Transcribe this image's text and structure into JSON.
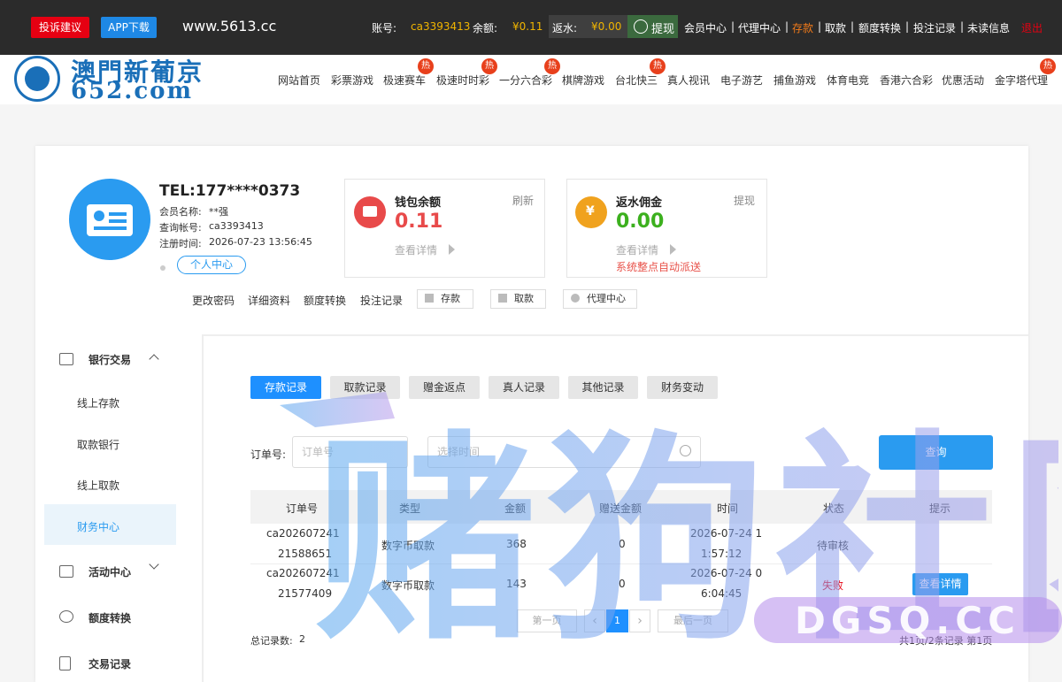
{
  "topbar": {
    "complaint_btn": "投诉建议",
    "app_btn": "APP下载",
    "site_url": "www.5613.cc",
    "account_label": "账号:",
    "account_value": "ca3393413",
    "balance_label": "余额:",
    "balance_value": "¥0.11",
    "rebate_label": "返水:",
    "rebate_value": "¥0.00",
    "withdraw_btn": "提现",
    "links": [
      "会员中心",
      "代理中心",
      "存款",
      "取款",
      "额度转换",
      "投注记录",
      "未读信息"
    ],
    "logout": "退出",
    "colors": {
      "accent_red": "#e60012",
      "accent_gold": "#f0b400",
      "bg": "#2b2b2b"
    }
  },
  "logo": {
    "line1": "澳門新葡京",
    "line2": "652.com",
    "color": "#1a6fb8"
  },
  "nav": {
    "items": [
      "网站首页",
      "彩票游戏",
      "极速赛车",
      "极速时时彩",
      "一分六合彩",
      "棋牌游戏",
      "台北快三",
      "真人视讯",
      "电子游艺",
      "捕鱼游戏",
      "体育电竞",
      "香港六合彩",
      "优惠活动",
      "金字塔代理"
    ],
    "hot_label": "热"
  },
  "user": {
    "tel": "TEL:177****0373",
    "member_name_label": "会员名称:",
    "member_name": "**强",
    "query_account_label": "查询帐号:",
    "query_account": "ca3393413",
    "register_label": "注册时间:",
    "register_time": "2026-07-23 13:56:45",
    "personal_center_btn": "个人中心"
  },
  "wallet": {
    "title": "钱包余额",
    "refresh": "刷新",
    "amount": "0.11",
    "detail": "查看详情"
  },
  "commission": {
    "title": "返水佣金",
    "withdraw": "提现",
    "amount": "0.00",
    "detail": "查看详情",
    "note": "系统整点自动派送"
  },
  "quick_links": [
    "更改密码",
    "详细资料",
    "额度转换",
    "投注记录"
  ],
  "quick_buttons": [
    "存款",
    "取款",
    "代理中心"
  ],
  "sidebar": {
    "bank_title": "银行交易",
    "bank_items": [
      "线上存款",
      "取款银行",
      "线上取款",
      "财务中心"
    ],
    "activity_title": "活动中心",
    "transfer_title": "额度转换",
    "records_title": "交易记录"
  },
  "tabs": [
    "存款记录",
    "取款记录",
    "赠金返点",
    "真人记录",
    "其他记录",
    "财务变动"
  ],
  "filter": {
    "order_label": "订单号:",
    "order_placeholder": "订单号",
    "time_placeholder": "选择时间",
    "search_btn": "查询"
  },
  "table": {
    "headers": [
      "订单号",
      "类型",
      "金额",
      "赠送金额",
      "时间",
      "状态",
      "提示"
    ],
    "rows": [
      {
        "order_l1": "ca202607241",
        "order_l2": "21588651",
        "type": "数字币取款",
        "amount": "368",
        "bonus": "0",
        "time_l1": "2026-07-24 1",
        "time_l2": "1:57:12",
        "status": "待审核",
        "tip": ""
      },
      {
        "order_l1": "ca202607241",
        "order_l2": "21577409",
        "type": "数字币取款",
        "amount": "143",
        "bonus": "0",
        "time_l1": "2026-07-24 0",
        "time_l2": "6:04:45",
        "status": "失败",
        "tip": "查看详情"
      }
    ],
    "status_fail_color": "#e60012"
  },
  "pagination": {
    "first": "第一页",
    "prev": "‹",
    "current": "1",
    "next": "›",
    "last": "最后一页",
    "total_label": "总记录数:",
    "total": "2",
    "summary": "共1页/2条记录 第1页"
  },
  "watermark": {
    "text_cn": "赌狗社区",
    "text_en": "DGSQ.CC"
  }
}
